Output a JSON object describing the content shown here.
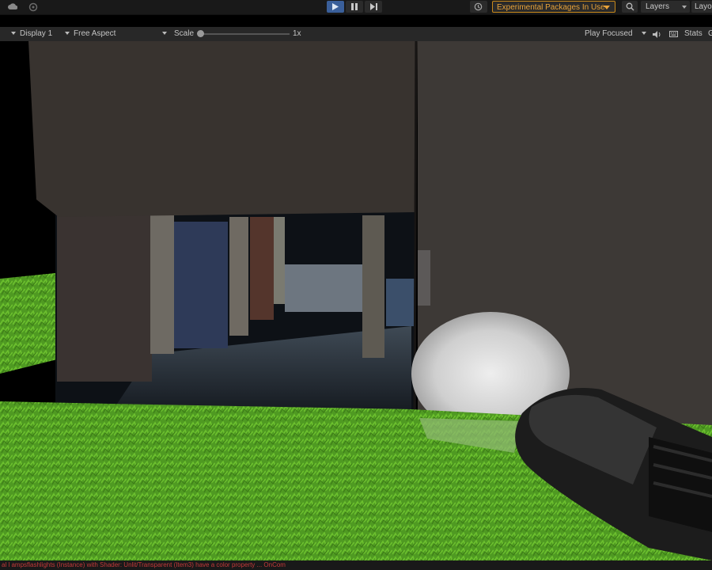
{
  "toolbar": {
    "experimental_label": "Experimental Packages In Use",
    "layers_label": "Layers",
    "layout_label": "Layo"
  },
  "game_view": {
    "display_label": "Display 1",
    "aspect_label": "Free Aspect",
    "scale_label": "Scale",
    "scale_value": "1x",
    "scale_fraction": 0.0,
    "play_mode_label": "Play Focused",
    "stats_label": "Stats",
    "gizmos_label": "G"
  },
  "status": {
    "message": "al l ampsflashlights (Instance) with Shader: Unlit/Transparent (Item3) have a color property ... OnCom"
  },
  "colors": {
    "accent_play": "#3a5f9a",
    "warning": "#e8a33a",
    "error_text": "#c43a3a"
  },
  "icons": [
    "cloud-icon",
    "collab-icon",
    "play-icon",
    "pause-icon",
    "step-icon",
    "history-icon",
    "search-icon",
    "audio-icon",
    "stats-keyboard-icon",
    "flashlight"
  ]
}
